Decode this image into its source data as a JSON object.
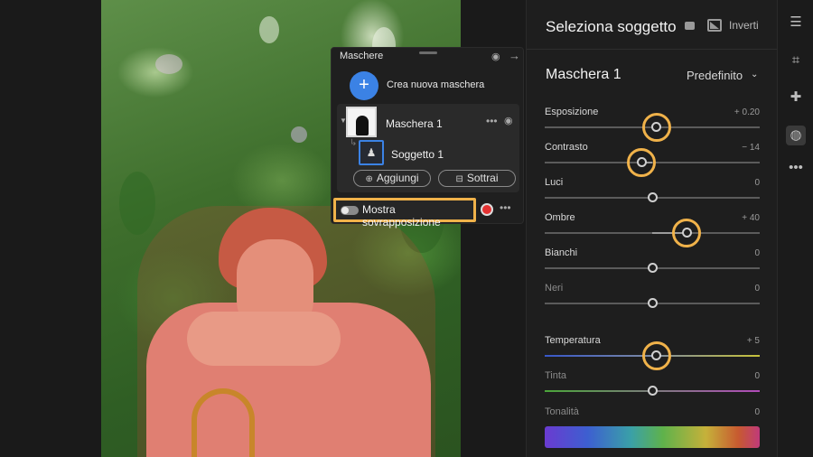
{
  "masks_panel": {
    "title": "Maschere",
    "create_label": "Crea nuova maschera",
    "mask_name": "Maschera 1",
    "subject_name": "Soggetto 1",
    "add_label": "Aggiungi",
    "subtract_label": "Sottrai",
    "overlay_label": "Mostra sovrapposizione",
    "overlay_color": "#e43232"
  },
  "panel": {
    "title": "Seleziona soggetto",
    "invert_label": "Inverti",
    "mask_heading": "Maschera 1",
    "preset": "Predefinito"
  },
  "sliders": [
    {
      "label": "Esposizione",
      "value_text": "+ 0.20",
      "position": 0.52,
      "highlighted": true,
      "dim": false
    },
    {
      "label": "Contrasto",
      "value_text": "− 14",
      "position": 0.45,
      "highlighted": true,
      "dim": false
    },
    {
      "label": "Luci",
      "value_text": "0",
      "position": 0.5,
      "highlighted": false,
      "dim": false
    },
    {
      "label": "Ombre",
      "value_text": "+ 40",
      "position": 0.66,
      "highlighted": true,
      "dim": false
    },
    {
      "label": "Bianchi",
      "value_text": "0",
      "position": 0.5,
      "highlighted": false,
      "dim": false
    },
    {
      "label": "Neri",
      "value_text": "0",
      "position": 0.5,
      "highlighted": false,
      "dim": true
    },
    {
      "label": "Temperatura",
      "value_text": "+ 5",
      "position": 0.52,
      "highlighted": true,
      "dim": false
    },
    {
      "label": "Tinta",
      "value_text": "0",
      "position": 0.5,
      "highlighted": false,
      "dim": true
    },
    {
      "label": "Tonalità",
      "value_text": "0",
      "position": 0.5,
      "highlighted": false,
      "dim": true
    }
  ],
  "toolbar": {
    "icons": [
      "sliders-icon",
      "crop-icon",
      "healing-icon",
      "masking-icon",
      "more-icon"
    ]
  }
}
